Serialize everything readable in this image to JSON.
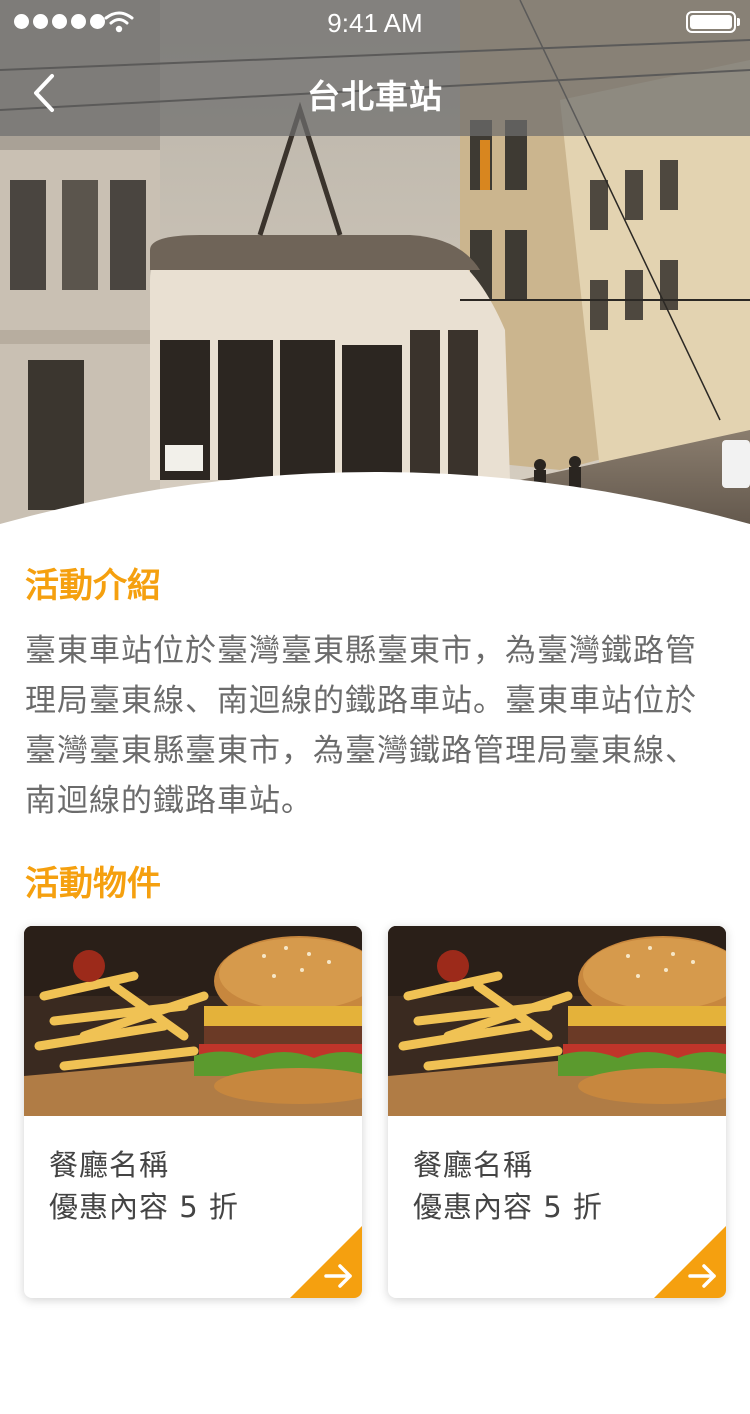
{
  "status_bar": {
    "time": "9:41 AM"
  },
  "header": {
    "title": "台北車站",
    "back_icon": "chevron-left-icon"
  },
  "intro": {
    "heading": "活動介紹",
    "text": "臺東車站位於臺灣臺東縣臺東市，為臺灣鐵路管理局臺東線、南迴線的鐵路車站。臺東車站位於臺灣臺東縣臺東市，為臺灣鐵路管理局臺東線、南迴線的鐵路車站。"
  },
  "items": {
    "heading": "活動物件",
    "cards": [
      {
        "name": "餐廳名稱",
        "offer": "優惠內容 5 折",
        "icon": "arrow-right-icon"
      },
      {
        "name": "餐廳名稱",
        "offer": "優惠內容 5 折",
        "icon": "arrow-right-icon"
      }
    ]
  },
  "colors": {
    "accent": "#f5a00f",
    "body_text": "#6b6b6b",
    "card_text": "#444444",
    "header_overlay": "#6e6e6e"
  }
}
